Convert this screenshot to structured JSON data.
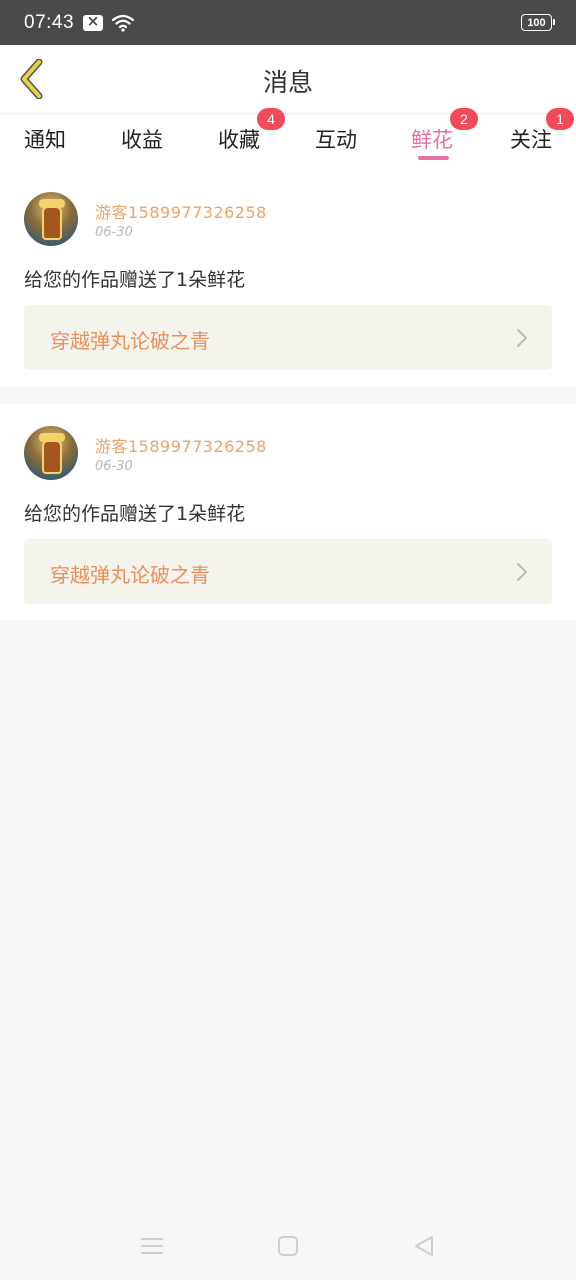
{
  "status_bar": {
    "time": "07:43",
    "battery": "100",
    "icons": [
      "notification-icon",
      "wifi-icon",
      "battery-icon"
    ]
  },
  "header": {
    "title": "消息",
    "back_icon": "chevron-left-icon"
  },
  "tabs": [
    {
      "label": "通知",
      "badge": null,
      "active": false
    },
    {
      "label": "收益",
      "badge": null,
      "active": false
    },
    {
      "label": "收藏",
      "badge": "4",
      "active": false
    },
    {
      "label": "互动",
      "badge": null,
      "active": false
    },
    {
      "label": "鲜花",
      "badge": "2",
      "active": true
    },
    {
      "label": "关注",
      "badge": "1",
      "active": false
    }
  ],
  "messages": [
    {
      "username": "游客15899773262​58",
      "date": "06-30",
      "text": "给您的作品赠送了1朵鲜花",
      "work_title": "穿越弹丸论破之青"
    },
    {
      "username": "游客1589977326258",
      "date": "06-30",
      "text": "给您的作品赠送了1朵鲜花",
      "work_title": "穿越弹丸论破之青"
    }
  ],
  "colors": {
    "accent": "#e76fa2",
    "badge": "#f04b5b",
    "username": "#e9a36b",
    "work_title": "#e9915d",
    "back_icon": "#e7d14a"
  },
  "nav_bar": [
    "menu-icon",
    "home-icon",
    "back-icon"
  ]
}
